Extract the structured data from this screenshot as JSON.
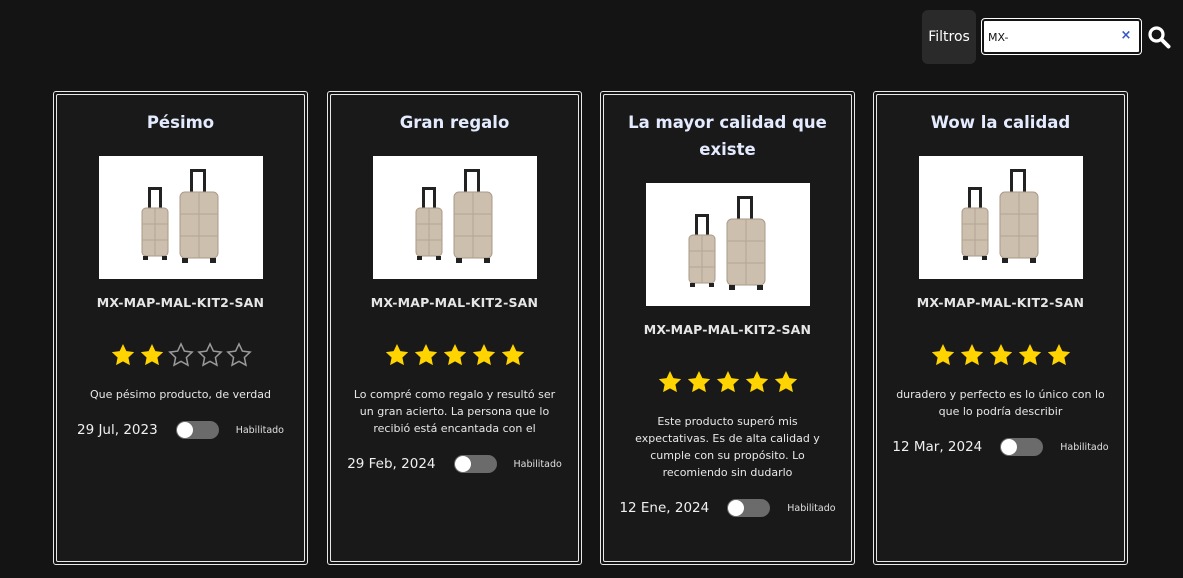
{
  "toolbar": {
    "filters_label": "Filtros",
    "search_value": "MX-",
    "clear_glyph": "×",
    "search_icon": "search-icon"
  },
  "colors": {
    "background": "#141414",
    "star_filled": "#ffd400",
    "star_empty": "#9a9a9a",
    "title": "#e4ebff",
    "toggle_off": "#6b6b6b"
  },
  "cards": [
    {
      "title": "Pésimo",
      "sku": "MX-MAP-MAL-KIT2-SAN",
      "rating": 2,
      "max_rating": 5,
      "review": "Que pésimo producto, de verdad",
      "date": "29 Jul, 2023",
      "toggle_label": "Habilitado",
      "enabled": false
    },
    {
      "title": "Gran regalo",
      "sku": "MX-MAP-MAL-KIT2-SAN",
      "rating": 5,
      "max_rating": 5,
      "review": "Lo compré como regalo y resultó ser un gran acierto. La persona que lo recibió está encantada con el",
      "date": "29 Feb, 2024",
      "toggle_label": "Habilitado",
      "enabled": false
    },
    {
      "title": "La mayor calidad que existe",
      "sku": "MX-MAP-MAL-KIT2-SAN",
      "rating": 5,
      "max_rating": 5,
      "review": "Este producto superó mis expectativas. Es de alta calidad y cumple con su propósito. Lo recomiendo sin dudarlo",
      "date": "12 Ene, 2024",
      "toggle_label": "Habilitado",
      "enabled": false
    },
    {
      "title": "Wow la calidad",
      "sku": "MX-MAP-MAL-KIT2-SAN",
      "rating": 5,
      "max_rating": 5,
      "review": "duradero y perfecto es lo único con lo que lo podría describir",
      "date": "12 Mar, 2024",
      "toggle_label": "Habilitado",
      "enabled": false
    }
  ]
}
